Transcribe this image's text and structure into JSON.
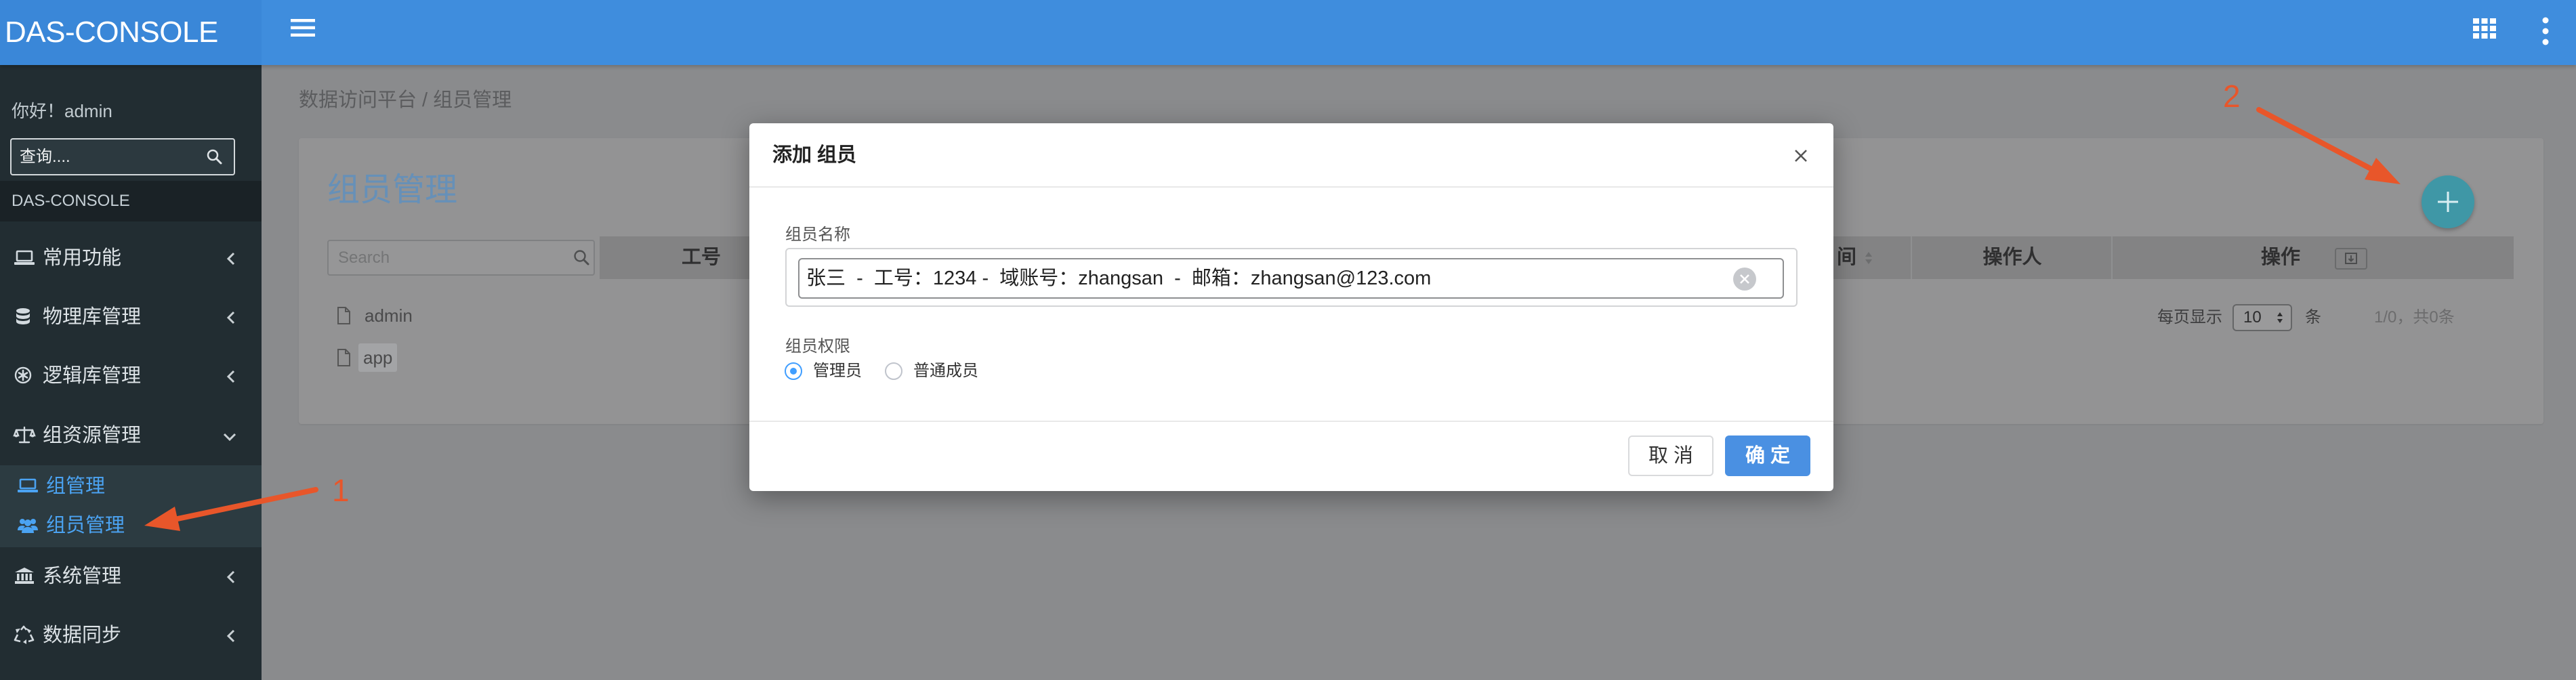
{
  "app": {
    "logo": "DAS-CONSOLE"
  },
  "topbar": {
    "menu_toggle_icon": "hamburger-icon",
    "apps_icon": "grid-icon",
    "more_icon": "kebab-icon"
  },
  "sidebar": {
    "greeting": "你好！admin",
    "search": {
      "placeholder": "查询...."
    },
    "section_label": "DAS-CONSOLE",
    "items": [
      {
        "label": "常用功能",
        "icon": "laptop-icon"
      },
      {
        "label": "物理库管理",
        "icon": "database-icon"
      },
      {
        "label": "逻辑库管理",
        "icon": "cog-icon"
      },
      {
        "label": "组资源管理",
        "icon": "balance-scale-icon",
        "expanded": true
      },
      {
        "label": "系统管理",
        "icon": "bank-icon"
      },
      {
        "label": "数据同步",
        "icon": "recycle-icon"
      }
    ],
    "submenu": [
      {
        "label": "组管理",
        "icon": "laptop-icon"
      },
      {
        "label": "组员管理",
        "icon": "users-icon",
        "active": true
      }
    ]
  },
  "breadcrumb": {
    "root": "数据访问平台",
    "separator": "/",
    "current": "组员管理"
  },
  "panel": {
    "title": "组员管理",
    "add_icon": "plus-icon",
    "tree_search_placeholder": "Search",
    "tree": [
      {
        "label": "admin",
        "selected": false
      },
      {
        "label": "app",
        "selected": true
      }
    ],
    "table_headers": [
      "工号",
      "间",
      "操作人",
      "操作"
    ],
    "pagination": {
      "per_page_label": "每页显示",
      "per_page": "10",
      "unit": "条",
      "summary": "1/0，共0条"
    }
  },
  "modal": {
    "title": "添加 组员",
    "name_label": "组员名称",
    "selected_member": "张三  -  工号：1234 -  域账号：zhangsan  -  邮箱：zhangsan@123.com",
    "permission_label": "组员权限",
    "permission_options": [
      {
        "label": "管理员",
        "checked": true
      },
      {
        "label": "普通成员",
        "checked": false
      }
    ],
    "cancel_label": "取 消",
    "confirm_label": "确 定"
  },
  "annotations": [
    {
      "label": "1"
    },
    {
      "label": "2"
    }
  ],
  "colors": {
    "header": "#3f8ddd",
    "sidebar": "#222d32",
    "primary": "#409eff",
    "annotation": "#e8562a",
    "submenu_text": "#4ba3f2"
  }
}
